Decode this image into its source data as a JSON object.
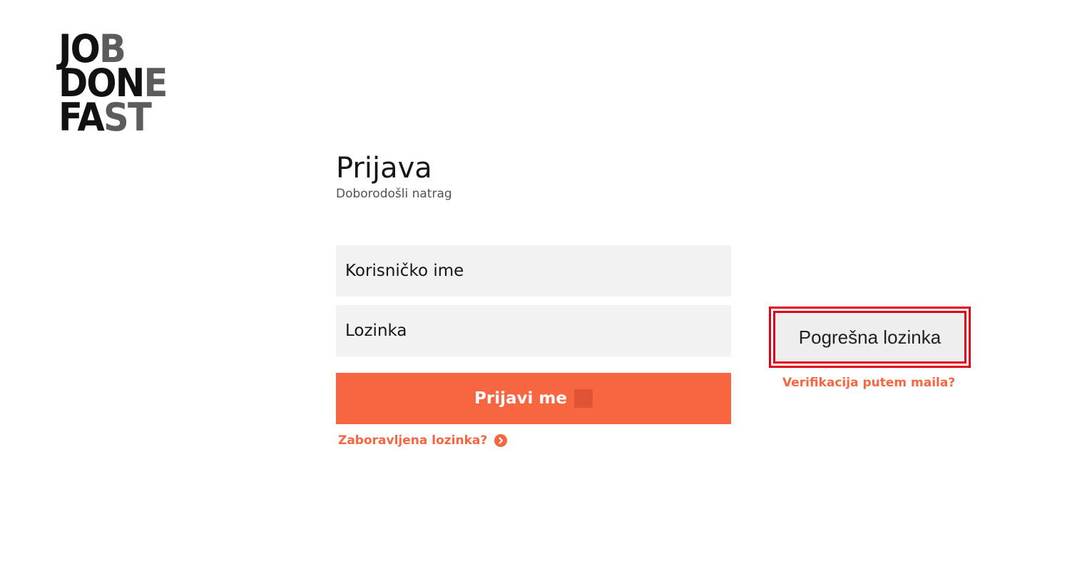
{
  "logo": {
    "line1_dark": "JO",
    "line1_grey": "B",
    "line2_dark": "DON",
    "line2_grey": "E",
    "line3_dark": "FA",
    "line3_grey": "ST"
  },
  "login": {
    "title": "Prijava",
    "subtitle": "Doborodošli natrag",
    "username_placeholder": "Korisničko ime",
    "password_placeholder": "Lozinka",
    "submit_label": "Prijavi me",
    "forgot_label": "Zaboravljena lozinka?",
    "forgot_icon": "chevron-right-circle-icon"
  },
  "error": {
    "message": "Pogrešna lozinka",
    "verify_link": "Verifikacija putem maila?"
  },
  "colors": {
    "accent": "#f76541",
    "error_border": "#e0001a",
    "input_bg": "#f2f2f2"
  }
}
